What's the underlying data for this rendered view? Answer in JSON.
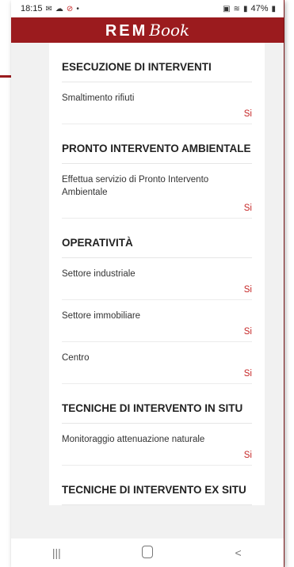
{
  "status_bar": {
    "time": "18:15",
    "left_icons": [
      "mail-icon",
      "cloud-icon",
      "app-icon"
    ],
    "battery": "47%",
    "right_icons": [
      "sim-icon",
      "wifi-icon",
      "signal-icon",
      "battery-icon"
    ]
  },
  "app_bar": {
    "logo_bold": "REM",
    "logo_script": "Book",
    "background": "#9b1b1e"
  },
  "sections": [
    {
      "title": "ESECUZIONE DI INTERVENTI",
      "items": [
        {
          "label": "Smaltimento rifiuti",
          "value": "Si"
        }
      ]
    },
    {
      "title": "PRONTO INTERVENTO AMBIENTALE",
      "items": [
        {
          "label": "Effettua servizio di Pronto Intervento Ambientale",
          "value": "Si"
        }
      ]
    },
    {
      "title": "OPERATIVITÀ",
      "items": [
        {
          "label": "Settore industriale",
          "value": "Si"
        },
        {
          "label": "Settore immobiliare",
          "value": "Si"
        },
        {
          "label": "Centro",
          "value": "Si"
        }
      ]
    },
    {
      "title": "TECNICHE DI INTERVENTO IN SITU",
      "items": [
        {
          "label": "Monitoraggio attenuazione naturale",
          "value": "Si"
        }
      ]
    },
    {
      "title": "TECNICHE DI INTERVENTO EX SITU",
      "items": []
    }
  ],
  "nav_bar": {
    "recents_label": "|||",
    "back_label": "<"
  },
  "colors": {
    "accent": "#9b1b1e",
    "value_red": "#c62828"
  }
}
